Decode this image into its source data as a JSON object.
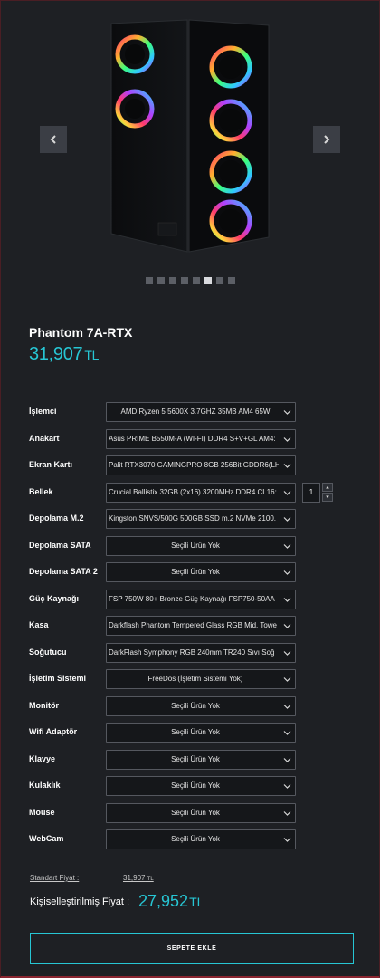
{
  "gallery": {
    "slide_count": 8,
    "active_slide": 6
  },
  "product": {
    "name": "Phantom 7A-RTX",
    "price_value": "31,907",
    "price_currency": "TL"
  },
  "configs": [
    {
      "label": "İşlemci",
      "value": "AMD Ryzen 5 5600X 3.7GHZ 35MB AM4 65W",
      "centered": true
    },
    {
      "label": "Anakart",
      "value": "Asus PRIME B550M-A (WI-FI) DDR4 S+V+GL AM4:",
      "centered": false
    },
    {
      "label": "Ekran Kartı",
      "value": "Palit RTX3070 GAMINGPRO 8GB 256Bit GDDR6(LH",
      "centered": false
    },
    {
      "label": "Bellek",
      "value": "Crucial Ballistix 32GB (2x16) 3200MHz DDR4 CL16:",
      "centered": false,
      "quantity": "1"
    },
    {
      "label": "Depolama M.2",
      "value": "Kingston SNVS/500G 500GB SSD m.2 NVMe 2100.",
      "centered": false
    },
    {
      "label": "Depolama SATA",
      "value": "Seçili Ürün Yok",
      "centered": true
    },
    {
      "label": "Depolama SATA 2",
      "value": "Seçili Ürün Yok",
      "centered": true
    },
    {
      "label": "Güç Kaynağı",
      "value": "FSP 750W 80+ Bronze Güç Kaynağı FSP750-50AA",
      "centered": false
    },
    {
      "label": "Kasa",
      "value": "Darkflash Phantom Tempered Glass RGB Mid. Towe",
      "centered": false
    },
    {
      "label": "Soğutucu",
      "value": "DarkFlash Symphony RGB 240mm TR240 Sıvı Soğ",
      "centered": false
    },
    {
      "label": "İşletim Sistemi",
      "value": "FreeDos (İşletim Sistemi Yok)",
      "centered": true
    },
    {
      "label": "Monitör",
      "value": "Seçili Ürün Yok",
      "centered": true
    },
    {
      "label": "Wifi Adaptör",
      "value": "Seçili Ürün Yok",
      "centered": true
    },
    {
      "label": "Klavye",
      "value": "Seçili Ürün Yok",
      "centered": true
    },
    {
      "label": "Kulaklık",
      "value": "Seçili Ürün Yok",
      "centered": true
    },
    {
      "label": "Mouse",
      "value": "Seçili Ürün Yok",
      "centered": true
    },
    {
      "label": "WebCam",
      "value": "Seçili Ürün Yok",
      "centered": true
    }
  ],
  "totals": {
    "standard_label": "Standart Fiyat :",
    "standard_value": "31,907",
    "standard_currency": "TL",
    "custom_label": "Kişiselleştirilmiş Fiyat :",
    "custom_value": "27,952",
    "custom_currency": "TL"
  },
  "cart": {
    "add_label": "SEPETE EKLE"
  },
  "colors": {
    "accent": "#27c6d4",
    "background": "#1e2024",
    "field": "#15171a"
  }
}
